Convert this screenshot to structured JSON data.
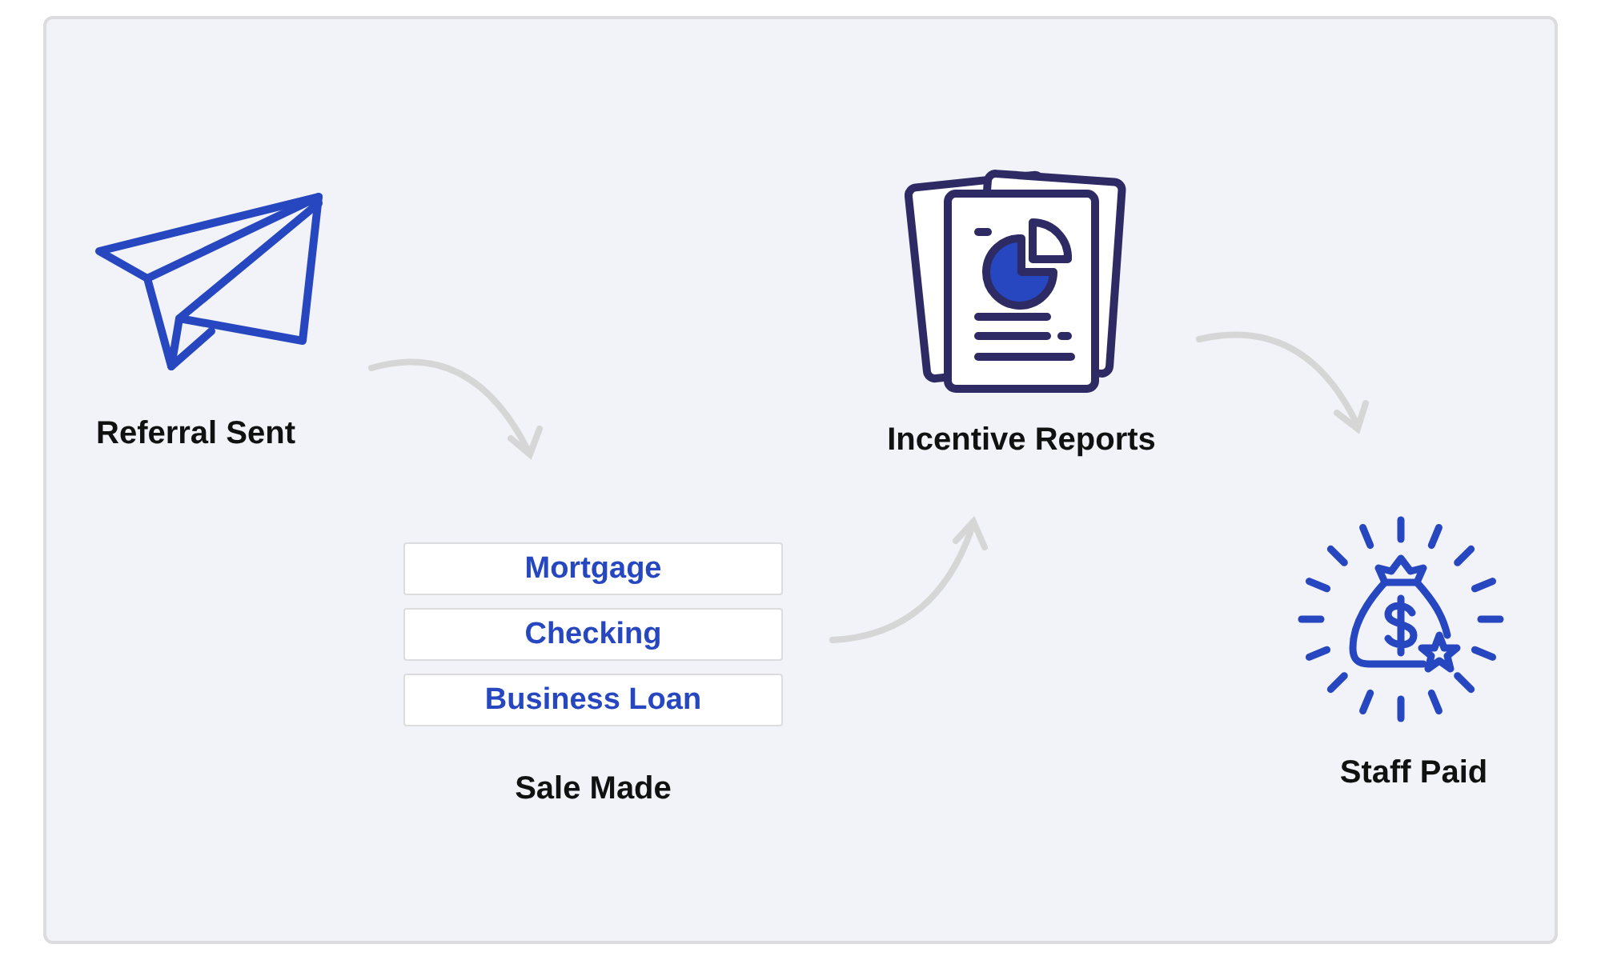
{
  "steps": [
    {
      "kind": "plane",
      "label": "Referral Sent"
    },
    {
      "kind": "products",
      "label": "Sale Made",
      "products": [
        "Mortgage",
        "Checking",
        "Business Loan"
      ]
    },
    {
      "kind": "reports",
      "label": "Incentive Reports"
    },
    {
      "kind": "moneybag",
      "label": "Staff Paid"
    }
  ]
}
